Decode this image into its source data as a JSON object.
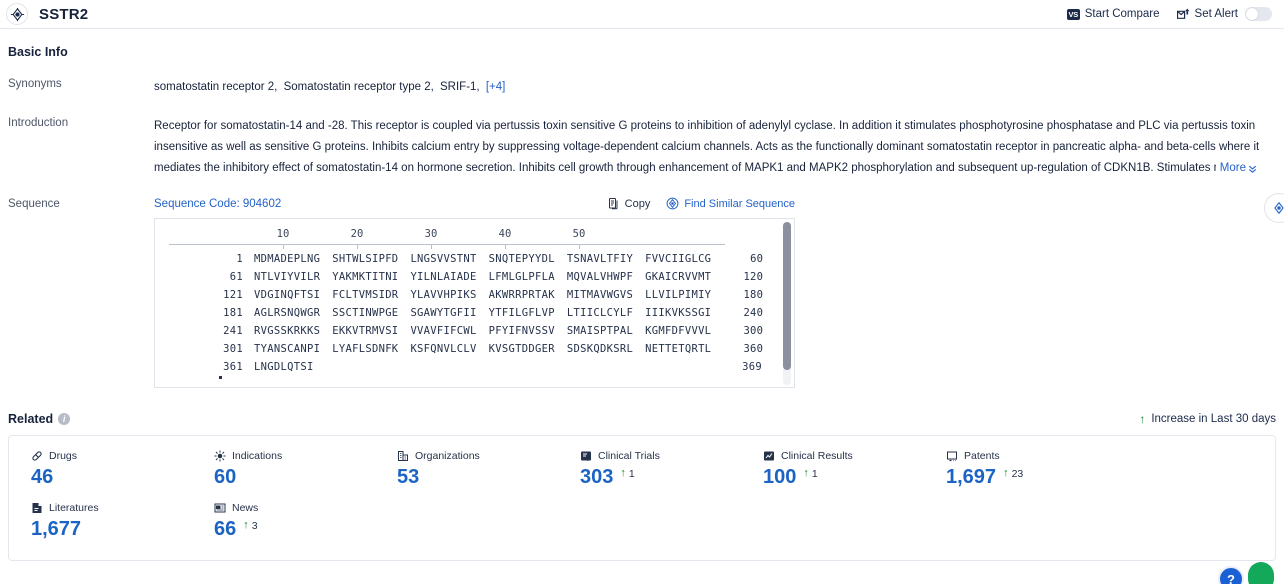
{
  "header": {
    "title": "SSTR2",
    "logo_icon": "target-icon",
    "start_compare": "Start Compare",
    "compare_icon_label": "VS",
    "set_alert": "Set Alert",
    "alert_icon": "alert-mail-icon",
    "toggle_state": "off"
  },
  "basic_info": {
    "section_title": "Basic Info",
    "synonyms_label": "Synonyms",
    "synonyms": [
      "somatostatin receptor 2,",
      "Somatostatin receptor type 2,",
      "SRIF-1,"
    ],
    "synonyms_more": "[+4]",
    "introduction_label": "Introduction",
    "introduction": "Receptor for somatostatin-14 and -28. This receptor is coupled via pertussis toxin sensitive G proteins to inhibition of adenylyl cyclase. In addition it stimulates phosphotyrosine phosphatase and PLC via pertussis toxin insensitive as well as sensitive G proteins. Inhibits calcium entry by suppressing voltage-dependent calcium channels. Acts as the functionally dominant somatostatin receptor in pancreatic alpha- and beta-cells where it mediates the inhibitory effect of somatostatin-14 on hormone secretion. Inhibits cell growth through enhancement of MAPK1 and MAPK2 phosphorylation and subsequent up-regulation of CDKN1B. Stimulates neuro",
    "more_label": "More"
  },
  "sequence": {
    "label": "Sequence",
    "code_label": "Sequence Code: 904602",
    "copy_label": "Copy",
    "find_similar_label": "Find Similar Sequence",
    "ruler": [
      10,
      20,
      30,
      40,
      50
    ],
    "lines": [
      {
        "start": "1",
        "chunks": [
          "MDMADEPLNG",
          "SHTWLSIPFD",
          "LNGSVVSTNT",
          "SNQTEPYYDL",
          "TSNAVLTFIY",
          "FVVCIIGLCG"
        ],
        "end": "60"
      },
      {
        "start": "61",
        "chunks": [
          "NTLVIYVILR",
          "YAKMKTITNI",
          "YILNLAIADE",
          "LFMLGLPFLA",
          "MQVALVHWPF",
          "GKAICRVVMT"
        ],
        "end": "120"
      },
      {
        "start": "121",
        "chunks": [
          "VDGINQFTSI",
          "FCLTVMSIDR",
          "YLAVVHPIKS",
          "AKWRRPRTAK",
          "MITMAVWGVS",
          "LLVILPIMIY"
        ],
        "end": "180"
      },
      {
        "start": "181",
        "chunks": [
          "AGLRSNQWGR",
          "SSCTINWPGE",
          "SGAWYTGFII",
          "YTFILGFLVP",
          "LTIICLCYLF",
          "IIIKVKSSGI"
        ],
        "end": "240"
      },
      {
        "start": "241",
        "chunks": [
          "RVGSSKRKKS",
          "EKKVTRMVSI",
          "VVAVFIFCWL",
          "PFYIFNVSSV",
          "SMAISPTPAL",
          "KGMFDFVVVL"
        ],
        "end": "300"
      },
      {
        "start": "301",
        "chunks": [
          "TYANSCANPI",
          "LYAFLSDNFK",
          "KSFQNVLCLV",
          "KVSGTDDGER",
          "SDSKQDKSRL",
          "NETTETQRTL"
        ],
        "end": "360"
      },
      {
        "start": "361",
        "chunks": [
          "LNGDLQTSI"
        ],
        "end": "369"
      }
    ]
  },
  "related": {
    "title": "Related",
    "info_glyph": "i",
    "legend": "Increase in Last 30 days",
    "legend_icon": "up-arrow-icon",
    "stats": [
      {
        "label": "Drugs",
        "icon": "pill-icon",
        "value": "46",
        "delta": ""
      },
      {
        "label": "Indications",
        "icon": "virus-icon",
        "value": "60",
        "delta": ""
      },
      {
        "label": "Organizations",
        "icon": "building-icon",
        "value": "53",
        "delta": ""
      },
      {
        "label": "Clinical Trials",
        "icon": "clinical-trial-icon",
        "value": "303",
        "delta": "1"
      },
      {
        "label": "Clinical Results",
        "icon": "clinical-result-icon",
        "value": "100",
        "delta": "1"
      },
      {
        "label": "Patents",
        "icon": "patent-icon",
        "value": "1,697",
        "delta": "23"
      },
      {
        "label": "Literatures",
        "icon": "literature-icon",
        "value": "1,677",
        "delta": ""
      },
      {
        "label": "News",
        "icon": "news-icon",
        "value": "66",
        "delta": "3"
      }
    ]
  },
  "floating": {
    "help_badge": "?",
    "right_icon": "target-icon"
  }
}
